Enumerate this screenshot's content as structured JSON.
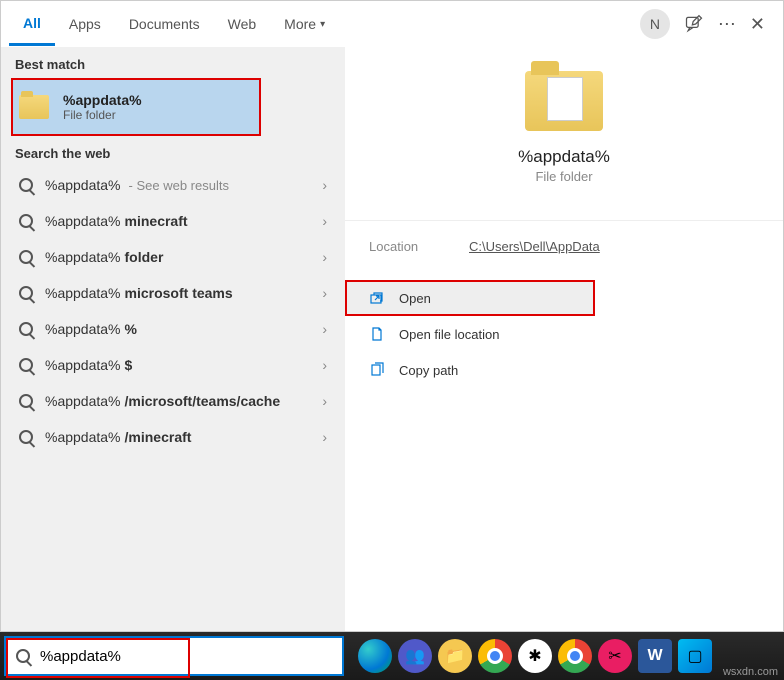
{
  "tabs": {
    "all": "All",
    "apps": "Apps",
    "documents": "Documents",
    "web": "Web",
    "more": "More"
  },
  "avatar_initial": "N",
  "sections": {
    "best_match": "Best match",
    "search_web": "Search the web"
  },
  "best_match": {
    "title": "%appdata%",
    "subtitle": "File folder"
  },
  "web_results": [
    {
      "prefix": "%appdata%",
      "bold": "",
      "hint": " - See web results"
    },
    {
      "prefix": "%appdata% ",
      "bold": "minecraft",
      "hint": ""
    },
    {
      "prefix": "%appdata% ",
      "bold": "folder",
      "hint": ""
    },
    {
      "prefix": "%appdata% ",
      "bold": "microsoft teams",
      "hint": ""
    },
    {
      "prefix": "%appdata%",
      "bold": "%",
      "hint": ""
    },
    {
      "prefix": "%appdata%",
      "bold": "$",
      "hint": ""
    },
    {
      "prefix": "%appdata%",
      "bold": "/microsoft/teams/cache",
      "hint": ""
    },
    {
      "prefix": "%appdata%",
      "bold": "/minecraft",
      "hint": ""
    }
  ],
  "preview": {
    "title": "%appdata%",
    "subtitle": "File folder",
    "location_label": "Location",
    "location_value": "C:\\Users\\Dell\\AppData",
    "actions": {
      "open": "Open",
      "open_location": "Open file location",
      "copy_path": "Copy path"
    }
  },
  "search_value": "%appdata%",
  "watermark": "wsxdn.com"
}
